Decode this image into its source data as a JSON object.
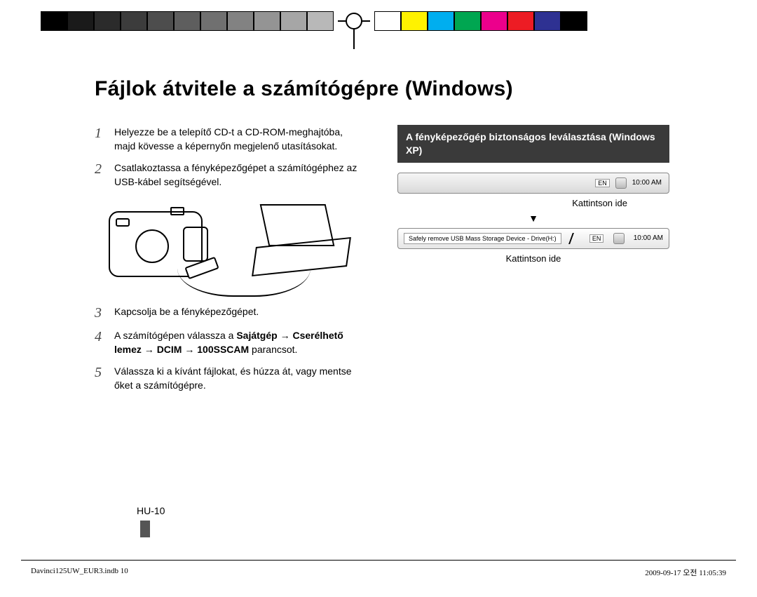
{
  "calibration_colors_left": [
    "#000000",
    "#1a1a1a",
    "#2b2b2b",
    "#3c3c3c",
    "#4d4d4d",
    "#5e5e5e",
    "#707070",
    "#828282",
    "#949494",
    "#a6a6a6",
    "#b8b8b8"
  ],
  "calibration_colors_right": [
    "#ffffff",
    "#fff200",
    "#00aeef",
    "#00a651",
    "#ec008c",
    "#ed1c24",
    "#2e3192",
    "#000000"
  ],
  "title": "Fájlok átvitele a számítógépre (Windows)",
  "steps": {
    "s1": {
      "num": "1",
      "text": "Helyezze be a telepítő CD-t a CD-ROM-meghajtóba, majd kövesse a képernyőn megjelenő utasításokat."
    },
    "s2": {
      "num": "2",
      "text": "Csatlakoztassa a fényképezőgépet a számítógéphez az USB-kábel segítségével."
    },
    "s3": {
      "num": "3",
      "text": "Kapcsolja be a fényképezőgépet."
    },
    "s4": {
      "num": "4",
      "pre": "A számítógépen válassza a ",
      "bold": "Sajátgép → Cserélhető lemez → DCIM → 100SSCAM",
      "post": " parancsot."
    },
    "s5": {
      "num": "5",
      "text": "Válassza ki a kívánt fájlokat, és húzza át, vagy mentse őket a számítógépre."
    }
  },
  "callout_title": "A fényképezőgép biztonságos leválasztása (Windows XP)",
  "taskbar": {
    "lang": "EN",
    "time": "10:00 AM"
  },
  "hint1": "Kattintson ide",
  "arrow": "▼",
  "balloon_text": "Safely remove USB Mass Storage Device - Drive(H:)",
  "taskbar2": {
    "lang": "EN",
    "time": "10:00 AM"
  },
  "hint2": "Kattintson ide",
  "page_number": "HU-10",
  "foot_left": "Davinci125UW_EUR3.indb   10",
  "foot_right": "2009-09-17   오전 11:05:39"
}
